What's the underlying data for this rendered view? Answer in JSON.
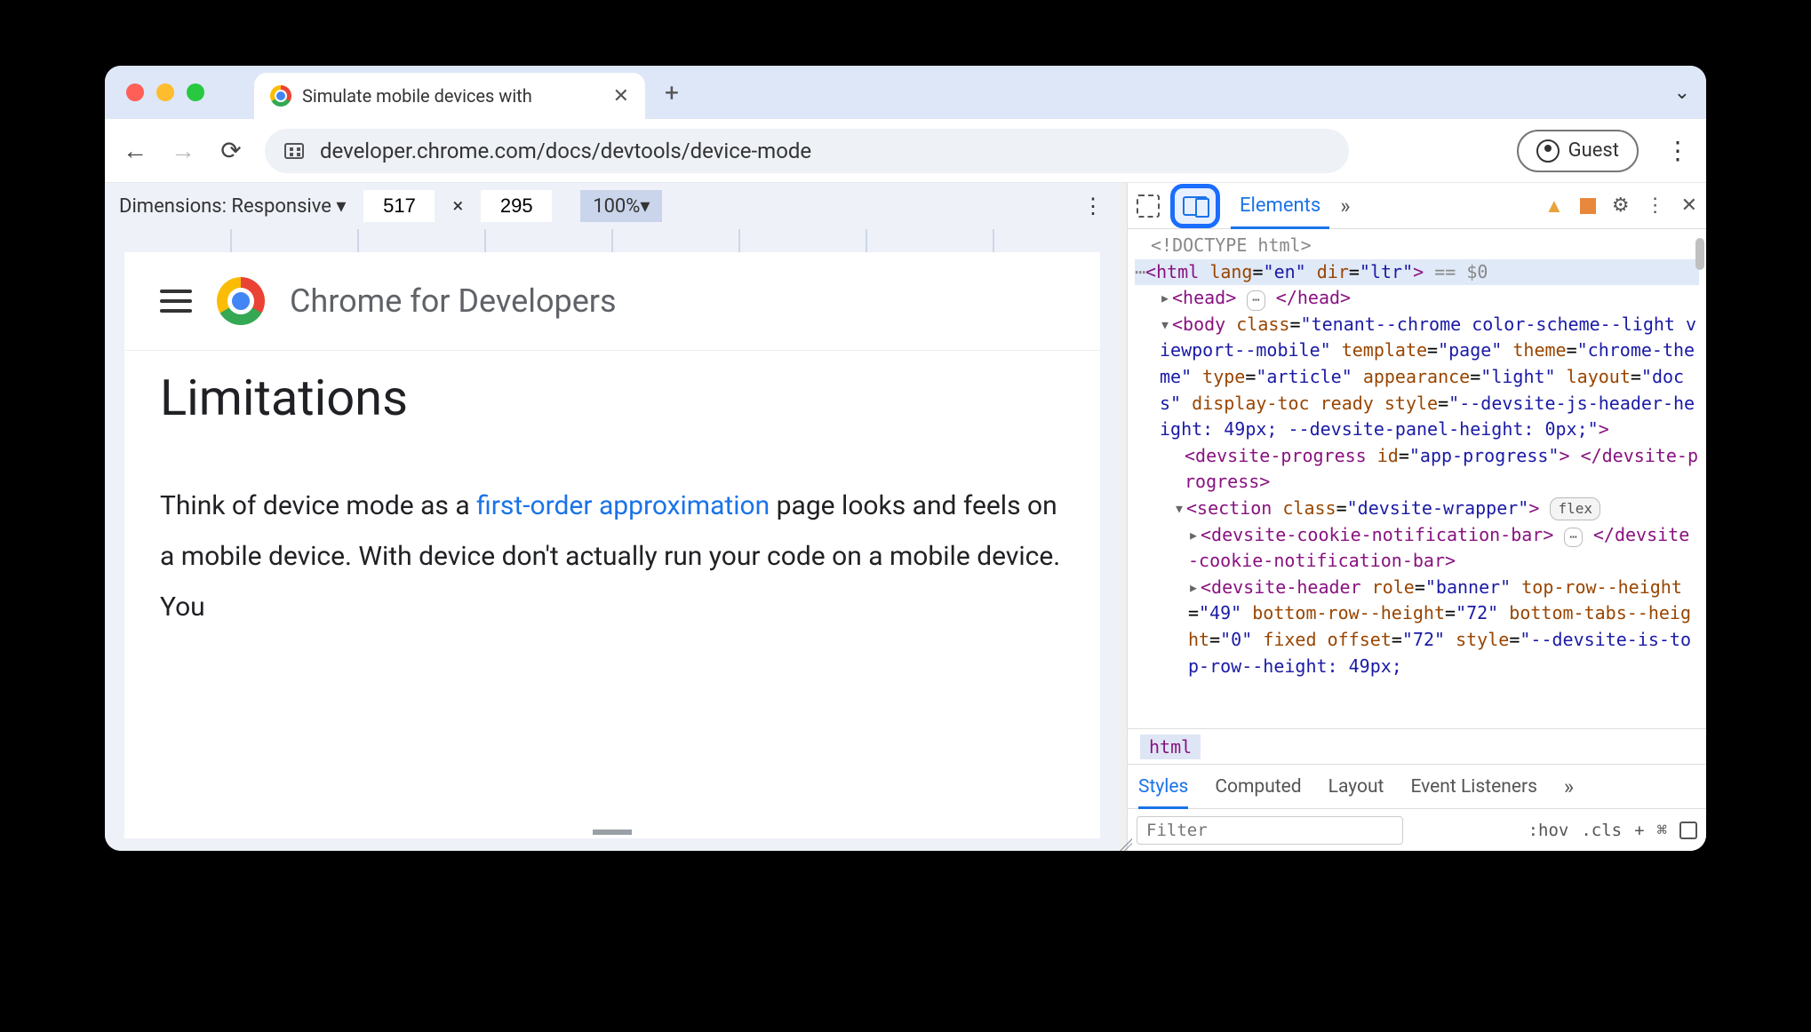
{
  "tab": {
    "title": "Simulate mobile devices with"
  },
  "toolbar": {
    "url": "developer.chrome.com/docs/devtools/device-mode",
    "profile_label": "Guest"
  },
  "devicebar": {
    "dims_label": "Dimensions: Responsive",
    "width": "517",
    "height": "295",
    "sep": "×",
    "zoom": "100%"
  },
  "page": {
    "brand": "Chrome for Developers",
    "heading": "Limitations",
    "body_pre": "Think of device mode as a ",
    "body_link": "first-order approximation",
    "body_post": " page looks and feels on a mobile device. With device don't actually run your code on a mobile device. You"
  },
  "devtools": {
    "tabs": {
      "elements": "Elements"
    },
    "dom": {
      "doctype": "<!DOCTYPE html>",
      "html_open": "<html lang=\"en\" dir=\"ltr\">",
      "html_sel": " == $0",
      "head": "<head> ⋯ </head>",
      "body_open": "<body class=\"tenant--chrome color-scheme--light viewport--mobile\" template=\"page\" theme=\"chrome-theme\" type=\"article\" appearance=\"light\" layout=\"docs\" display-toc ready style=\"--devsite-js-header-height: 49px; --devsite-panel-height: 0px;\">",
      "progress": "<devsite-progress id=\"app-progress\"> </devsite-progress>",
      "section_open": "<section class=\"devsite-wrapper\">",
      "section_pill": "flex",
      "cookie": "<devsite-cookie-notification-bar> ⋯ </devsite-cookie-notification-bar>",
      "header_open": "<devsite-header role=\"banner\" top-row--height=\"49\" bottom-row--height=\"72\" bottom-tabs--height=\"0\" fixed offset=\"72\" style=\"--devsite-is-top-row--height: 49px;"
    },
    "breadcrumb": "html",
    "styles_tabs": {
      "styles": "Styles",
      "computed": "Computed",
      "layout": "Layout",
      "listeners": "Event Listeners"
    },
    "styles_bar": {
      "filter_ph": "Filter",
      "hov": ":hov",
      "cls": ".cls",
      "plus": "+"
    }
  }
}
